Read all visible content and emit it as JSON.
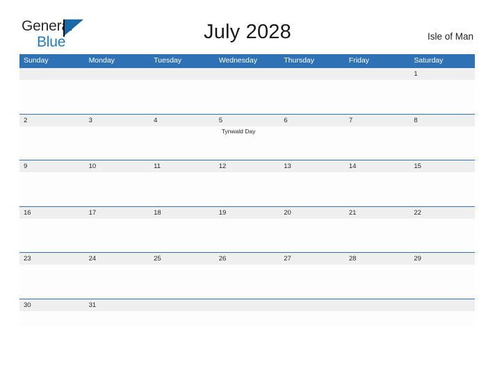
{
  "brand": {
    "name_part1": "General",
    "name_part2": "Blue",
    "flag_icon": "flag-icon"
  },
  "header": {
    "title": "July 2028",
    "location": "Isle of Man"
  },
  "colors": {
    "header_blue": "#2e72b5",
    "brand_blue": "#1d7dc4",
    "number_band_gray": "#efefef",
    "separator_blue": "#2e72b5"
  },
  "calendar": {
    "weekdays": [
      "Sunday",
      "Monday",
      "Tuesday",
      "Wednesday",
      "Thursday",
      "Friday",
      "Saturday"
    ],
    "weeks": [
      {
        "days": [
          {
            "number": "",
            "event": ""
          },
          {
            "number": "",
            "event": ""
          },
          {
            "number": "",
            "event": ""
          },
          {
            "number": "",
            "event": ""
          },
          {
            "number": "",
            "event": ""
          },
          {
            "number": "",
            "event": ""
          },
          {
            "number": "1",
            "event": ""
          }
        ]
      },
      {
        "days": [
          {
            "number": "2",
            "event": ""
          },
          {
            "number": "3",
            "event": ""
          },
          {
            "number": "4",
            "event": ""
          },
          {
            "number": "5",
            "event": "Tynwald Day"
          },
          {
            "number": "6",
            "event": ""
          },
          {
            "number": "7",
            "event": ""
          },
          {
            "number": "8",
            "event": ""
          }
        ]
      },
      {
        "days": [
          {
            "number": "9",
            "event": ""
          },
          {
            "number": "10",
            "event": ""
          },
          {
            "number": "11",
            "event": ""
          },
          {
            "number": "12",
            "event": ""
          },
          {
            "number": "13",
            "event": ""
          },
          {
            "number": "14",
            "event": ""
          },
          {
            "number": "15",
            "event": ""
          }
        ]
      },
      {
        "days": [
          {
            "number": "16",
            "event": ""
          },
          {
            "number": "17",
            "event": ""
          },
          {
            "number": "18",
            "event": ""
          },
          {
            "number": "19",
            "event": ""
          },
          {
            "number": "20",
            "event": ""
          },
          {
            "number": "21",
            "event": ""
          },
          {
            "number": "22",
            "event": ""
          }
        ]
      },
      {
        "days": [
          {
            "number": "23",
            "event": ""
          },
          {
            "number": "24",
            "event": ""
          },
          {
            "number": "25",
            "event": ""
          },
          {
            "number": "26",
            "event": ""
          },
          {
            "number": "27",
            "event": ""
          },
          {
            "number": "28",
            "event": ""
          },
          {
            "number": "29",
            "event": ""
          }
        ]
      },
      {
        "days": [
          {
            "number": "30",
            "event": ""
          },
          {
            "number": "31",
            "event": ""
          },
          {
            "number": "",
            "event": ""
          },
          {
            "number": "",
            "event": ""
          },
          {
            "number": "",
            "event": ""
          },
          {
            "number": "",
            "event": ""
          },
          {
            "number": "",
            "event": ""
          }
        ]
      }
    ]
  }
}
